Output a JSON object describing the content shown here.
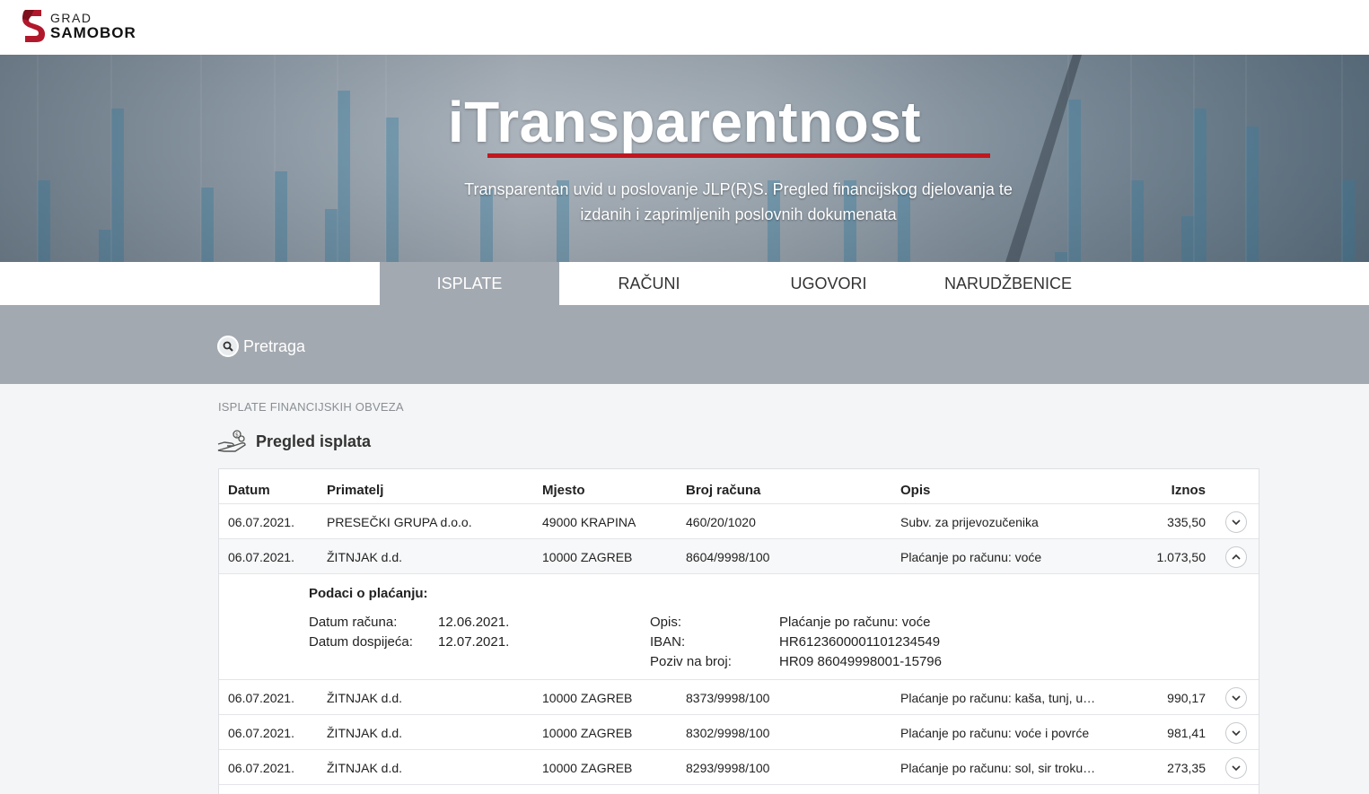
{
  "brand": {
    "line1": "GRAD",
    "line2": "SAMOBOR"
  },
  "hero": {
    "title": "iTransparentnost",
    "subtitle": "Transparentan uvid u poslovanje JLP(R)S. Pregled financijskog djelovanja te izdanih i zaprimljenih poslovnih dokumenata",
    "accent_color": "#c0181f"
  },
  "tabs": [
    {
      "label": "ISPLATE",
      "active": true
    },
    {
      "label": "RAČUNI",
      "active": false
    },
    {
      "label": "UGOVORI",
      "active": false
    },
    {
      "label": "NARUDŽBENICE",
      "active": false
    }
  ],
  "search": {
    "label": "Pretraga",
    "icon": "search-icon"
  },
  "section": {
    "kicker": "ISPLATE FINANCIJSKIH OBVEZA",
    "title": "Pregled isplata",
    "icon": "money-hand-icon"
  },
  "table": {
    "columns": {
      "datum": "Datum",
      "primatelj": "Primatelj",
      "mjesto": "Mjesto",
      "broj": "Broj računa",
      "opis": "Opis",
      "iznos": "Iznos"
    },
    "rows": [
      {
        "datum": "06.07.2021.",
        "primatelj": "PRESEČKI GRUPA d.o.o.",
        "mjesto": "49000 KRAPINA",
        "broj": "460/20/1020",
        "opis": "Subv. za prijevozučenika",
        "iznos": "335,50",
        "expanded": false
      },
      {
        "datum": "06.07.2021.",
        "primatelj": "ŽITNJAK d.d.",
        "mjesto": "10000 ZAGREB",
        "broj": "8604/9998/100",
        "opis": "Plaćanje po računu: voće",
        "iznos": "1.073,50",
        "expanded": true
      },
      {
        "datum": "06.07.2021.",
        "primatelj": "ŽITNJAK d.d.",
        "mjesto": "10000 ZAGREB",
        "broj": "8373/9998/100",
        "opis": "Plaćanje po računu: kaša, tunj, u…",
        "iznos": "990,17",
        "expanded": false
      },
      {
        "datum": "06.07.2021.",
        "primatelj": "ŽITNJAK d.d.",
        "mjesto": "10000 ZAGREB",
        "broj": "8302/9998/100",
        "opis": "Plaćanje po računu: voće i povrće",
        "iznos": "981,41",
        "expanded": false
      },
      {
        "datum": "06.07.2021.",
        "primatelj": "ŽITNJAK d.d.",
        "mjesto": "10000 ZAGREB",
        "broj": "8293/9998/100",
        "opis": "Plaćanje po računu: sol, sir troku…",
        "iznos": "273,35",
        "expanded": false
      }
    ],
    "details": {
      "title": "Podaci o plaćanju:",
      "datum_racuna_label": "Datum računa:",
      "datum_racuna": "12.06.2021.",
      "datum_dospijeca_label": "Datum dospijeća:",
      "datum_dospijeca": "12.07.2021.",
      "opis_label": "Opis:",
      "opis": "Plaćanje po računu: voće",
      "iban_label": "IBAN:",
      "iban": "HR6123600001101234549",
      "poziv_label": "Poziv na broj:",
      "poziv": "HR09 86049998001-15796"
    }
  }
}
